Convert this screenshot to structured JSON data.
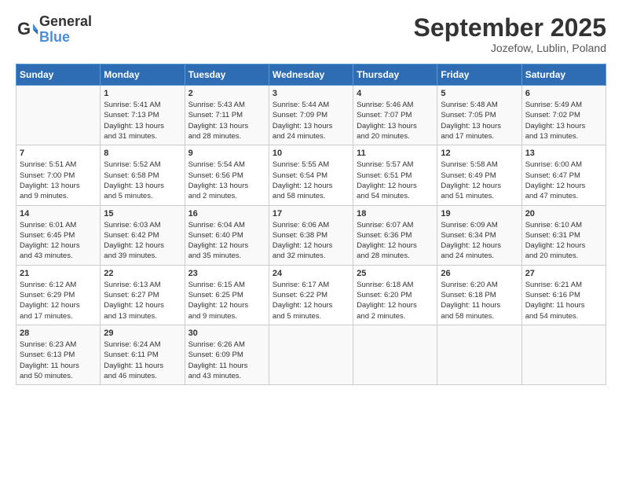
{
  "header": {
    "logo_line1": "General",
    "logo_line2": "Blue",
    "title": "September 2025",
    "subtitle": "Jozefow, Lublin, Poland"
  },
  "days_of_week": [
    "Sunday",
    "Monday",
    "Tuesday",
    "Wednesday",
    "Thursday",
    "Friday",
    "Saturday"
  ],
  "weeks": [
    [
      {
        "day": "",
        "info": ""
      },
      {
        "day": "1",
        "info": "Sunrise: 5:41 AM\nSunset: 7:13 PM\nDaylight: 13 hours\nand 31 minutes."
      },
      {
        "day": "2",
        "info": "Sunrise: 5:43 AM\nSunset: 7:11 PM\nDaylight: 13 hours\nand 28 minutes."
      },
      {
        "day": "3",
        "info": "Sunrise: 5:44 AM\nSunset: 7:09 PM\nDaylight: 13 hours\nand 24 minutes."
      },
      {
        "day": "4",
        "info": "Sunrise: 5:46 AM\nSunset: 7:07 PM\nDaylight: 13 hours\nand 20 minutes."
      },
      {
        "day": "5",
        "info": "Sunrise: 5:48 AM\nSunset: 7:05 PM\nDaylight: 13 hours\nand 17 minutes."
      },
      {
        "day": "6",
        "info": "Sunrise: 5:49 AM\nSunset: 7:02 PM\nDaylight: 13 hours\nand 13 minutes."
      }
    ],
    [
      {
        "day": "7",
        "info": "Sunrise: 5:51 AM\nSunset: 7:00 PM\nDaylight: 13 hours\nand 9 minutes."
      },
      {
        "day": "8",
        "info": "Sunrise: 5:52 AM\nSunset: 6:58 PM\nDaylight: 13 hours\nand 5 minutes."
      },
      {
        "day": "9",
        "info": "Sunrise: 5:54 AM\nSunset: 6:56 PM\nDaylight: 13 hours\nand 2 minutes."
      },
      {
        "day": "10",
        "info": "Sunrise: 5:55 AM\nSunset: 6:54 PM\nDaylight: 12 hours\nand 58 minutes."
      },
      {
        "day": "11",
        "info": "Sunrise: 5:57 AM\nSunset: 6:51 PM\nDaylight: 12 hours\nand 54 minutes."
      },
      {
        "day": "12",
        "info": "Sunrise: 5:58 AM\nSunset: 6:49 PM\nDaylight: 12 hours\nand 51 minutes."
      },
      {
        "day": "13",
        "info": "Sunrise: 6:00 AM\nSunset: 6:47 PM\nDaylight: 12 hours\nand 47 minutes."
      }
    ],
    [
      {
        "day": "14",
        "info": "Sunrise: 6:01 AM\nSunset: 6:45 PM\nDaylight: 12 hours\nand 43 minutes."
      },
      {
        "day": "15",
        "info": "Sunrise: 6:03 AM\nSunset: 6:42 PM\nDaylight: 12 hours\nand 39 minutes."
      },
      {
        "day": "16",
        "info": "Sunrise: 6:04 AM\nSunset: 6:40 PM\nDaylight: 12 hours\nand 35 minutes."
      },
      {
        "day": "17",
        "info": "Sunrise: 6:06 AM\nSunset: 6:38 PM\nDaylight: 12 hours\nand 32 minutes."
      },
      {
        "day": "18",
        "info": "Sunrise: 6:07 AM\nSunset: 6:36 PM\nDaylight: 12 hours\nand 28 minutes."
      },
      {
        "day": "19",
        "info": "Sunrise: 6:09 AM\nSunset: 6:34 PM\nDaylight: 12 hours\nand 24 minutes."
      },
      {
        "day": "20",
        "info": "Sunrise: 6:10 AM\nSunset: 6:31 PM\nDaylight: 12 hours\nand 20 minutes."
      }
    ],
    [
      {
        "day": "21",
        "info": "Sunrise: 6:12 AM\nSunset: 6:29 PM\nDaylight: 12 hours\nand 17 minutes."
      },
      {
        "day": "22",
        "info": "Sunrise: 6:13 AM\nSunset: 6:27 PM\nDaylight: 12 hours\nand 13 minutes."
      },
      {
        "day": "23",
        "info": "Sunrise: 6:15 AM\nSunset: 6:25 PM\nDaylight: 12 hours\nand 9 minutes."
      },
      {
        "day": "24",
        "info": "Sunrise: 6:17 AM\nSunset: 6:22 PM\nDaylight: 12 hours\nand 5 minutes."
      },
      {
        "day": "25",
        "info": "Sunrise: 6:18 AM\nSunset: 6:20 PM\nDaylight: 12 hours\nand 2 minutes."
      },
      {
        "day": "26",
        "info": "Sunrise: 6:20 AM\nSunset: 6:18 PM\nDaylight: 11 hours\nand 58 minutes."
      },
      {
        "day": "27",
        "info": "Sunrise: 6:21 AM\nSunset: 6:16 PM\nDaylight: 11 hours\nand 54 minutes."
      }
    ],
    [
      {
        "day": "28",
        "info": "Sunrise: 6:23 AM\nSunset: 6:13 PM\nDaylight: 11 hours\nand 50 minutes."
      },
      {
        "day": "29",
        "info": "Sunrise: 6:24 AM\nSunset: 6:11 PM\nDaylight: 11 hours\nand 46 minutes."
      },
      {
        "day": "30",
        "info": "Sunrise: 6:26 AM\nSunset: 6:09 PM\nDaylight: 11 hours\nand 43 minutes."
      },
      {
        "day": "",
        "info": ""
      },
      {
        "day": "",
        "info": ""
      },
      {
        "day": "",
        "info": ""
      },
      {
        "day": "",
        "info": ""
      }
    ]
  ]
}
